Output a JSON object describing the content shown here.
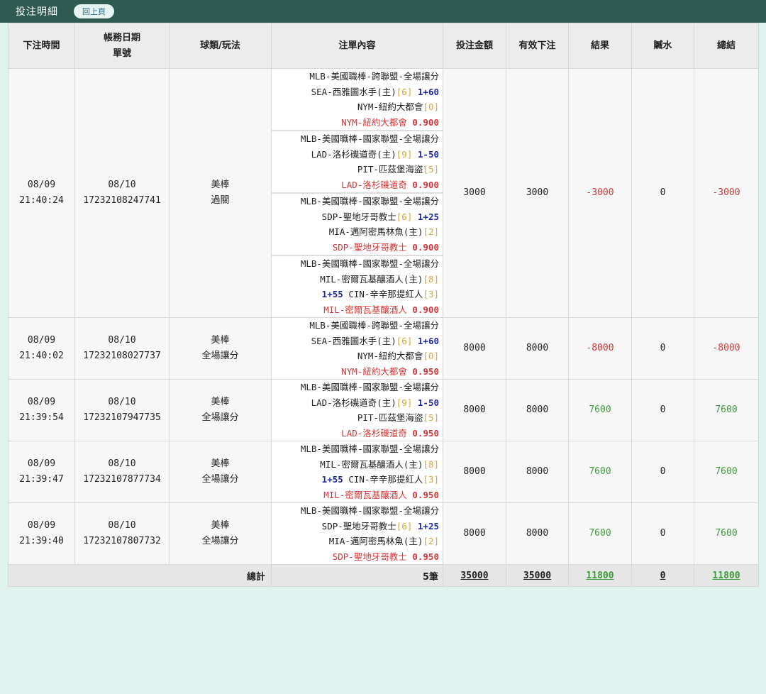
{
  "header": {
    "title": "投注明細",
    "back_label": "回上頁"
  },
  "columns": [
    "下注時間",
    "帳務日期",
    "單號",
    "球類/玩法",
    "注單內容",
    "投注金額",
    "有效下注",
    "結果",
    "贓水",
    "總結"
  ],
  "bets": [
    {
      "date": "08/09",
      "time": "21:40:24",
      "acct_date": "08/10",
      "ticket": "17232108247741",
      "sport": "美棒",
      "play": "過關",
      "amount": "3000",
      "valid": "3000",
      "result": "-3000",
      "rebate": "0",
      "total": "-3000",
      "status": "neg",
      "legs": [
        {
          "league": "MLB-美國職棒-跨聯盟-全場讓分",
          "l2a": "SEA-西雅圖水手(主)",
          "l2p": "[6]",
          "l2h": "1+60",
          "l3a": "",
          "l3b": "NYM-紐約大都會",
          "l3p": "[0]",
          "pick": "NYM-紐約大都會",
          "odds": "0.900"
        },
        {
          "league": "MLB-美國職棒-國家聯盟-全場讓分",
          "l2a": "LAD-洛杉磯道奇(主)",
          "l2p": "[9]",
          "l2h": "1-50",
          "l3a": "",
          "l3b": "PIT-匹茲堡海盜",
          "l3p": "[5]",
          "pick": "LAD-洛杉磯道奇",
          "odds": "0.900"
        },
        {
          "league": "MLB-美國職棒-國家聯盟-全場讓分",
          "l2a": "SDP-聖地牙哥教士",
          "l2p": "[6]",
          "l2h": "1+25",
          "l3a": "",
          "l3b": "MIA-邁阿密馬林魚(主)",
          "l3p": "[2]",
          "pick": "SDP-聖地牙哥教士",
          "odds": "0.900"
        },
        {
          "league": "MLB-美國職棒-國家聯盟-全場讓分",
          "l2a": "MIL-密爾瓦基釀酒人(主)",
          "l2p": "[8]",
          "l2h": "",
          "l3a": "1+55",
          "l3b": "CIN-辛辛那提紅人",
          "l3p": "[3]",
          "pick": "MIL-密爾瓦基釀酒人",
          "odds": "0.900"
        }
      ]
    },
    {
      "date": "08/09",
      "time": "21:40:02",
      "acct_date": "08/10",
      "ticket": "17232108027737",
      "sport": "美棒",
      "play": "全場讓分",
      "amount": "8000",
      "valid": "8000",
      "result": "-8000",
      "rebate": "0",
      "total": "-8000",
      "status": "neg",
      "legs": [
        {
          "league": "MLB-美國職棒-跨聯盟-全場讓分",
          "l2a": "SEA-西雅圖水手(主)",
          "l2p": "[6]",
          "l2h": "1+60",
          "l3a": "",
          "l3b": "NYM-紐約大都會",
          "l3p": "[0]",
          "pick": "NYM-紐約大都會",
          "odds": "0.950"
        }
      ]
    },
    {
      "date": "08/09",
      "time": "21:39:54",
      "acct_date": "08/10",
      "ticket": "17232107947735",
      "sport": "美棒",
      "play": "全場讓分",
      "amount": "8000",
      "valid": "8000",
      "result": "7600",
      "rebate": "0",
      "total": "7600",
      "status": "pos",
      "legs": [
        {
          "league": "MLB-美國職棒-國家聯盟-全場讓分",
          "l2a": "LAD-洛杉磯道奇(主)",
          "l2p": "[9]",
          "l2h": "1-50",
          "l3a": "",
          "l3b": "PIT-匹茲堡海盜",
          "l3p": "[5]",
          "pick": "LAD-洛杉磯道奇",
          "odds": "0.950"
        }
      ]
    },
    {
      "date": "08/09",
      "time": "21:39:47",
      "acct_date": "08/10",
      "ticket": "17232107877734",
      "sport": "美棒",
      "play": "全場讓分",
      "amount": "8000",
      "valid": "8000",
      "result": "7600",
      "rebate": "0",
      "total": "7600",
      "status": "pos",
      "legs": [
        {
          "league": "MLB-美國職棒-國家聯盟-全場讓分",
          "l2a": "MIL-密爾瓦基釀酒人(主)",
          "l2p": "[8]",
          "l2h": "",
          "l3a": "1+55",
          "l3b": "CIN-辛辛那提紅人",
          "l3p": "[3]",
          "pick": "MIL-密爾瓦基釀酒人",
          "odds": "0.950"
        }
      ]
    },
    {
      "date": "08/09",
      "time": "21:39:40",
      "acct_date": "08/10",
      "ticket": "17232107807732",
      "sport": "美棒",
      "play": "全場讓分",
      "amount": "8000",
      "valid": "8000",
      "result": "7600",
      "rebate": "0",
      "total": "7600",
      "status": "pos",
      "legs": [
        {
          "league": "MLB-美國職棒-國家聯盟-全場讓分",
          "l2a": "SDP-聖地牙哥教士",
          "l2p": "[6]",
          "l2h": "1+25",
          "l3a": "",
          "l3b": "MIA-邁阿密馬林魚(主)",
          "l3p": "[2]",
          "pick": "SDP-聖地牙哥教士",
          "odds": "0.950"
        }
      ]
    }
  ],
  "footer": {
    "label": "總計",
    "count": "5筆",
    "amount": "35000",
    "valid": "35000",
    "result": "11800",
    "rebate": "0",
    "total": "11800"
  }
}
